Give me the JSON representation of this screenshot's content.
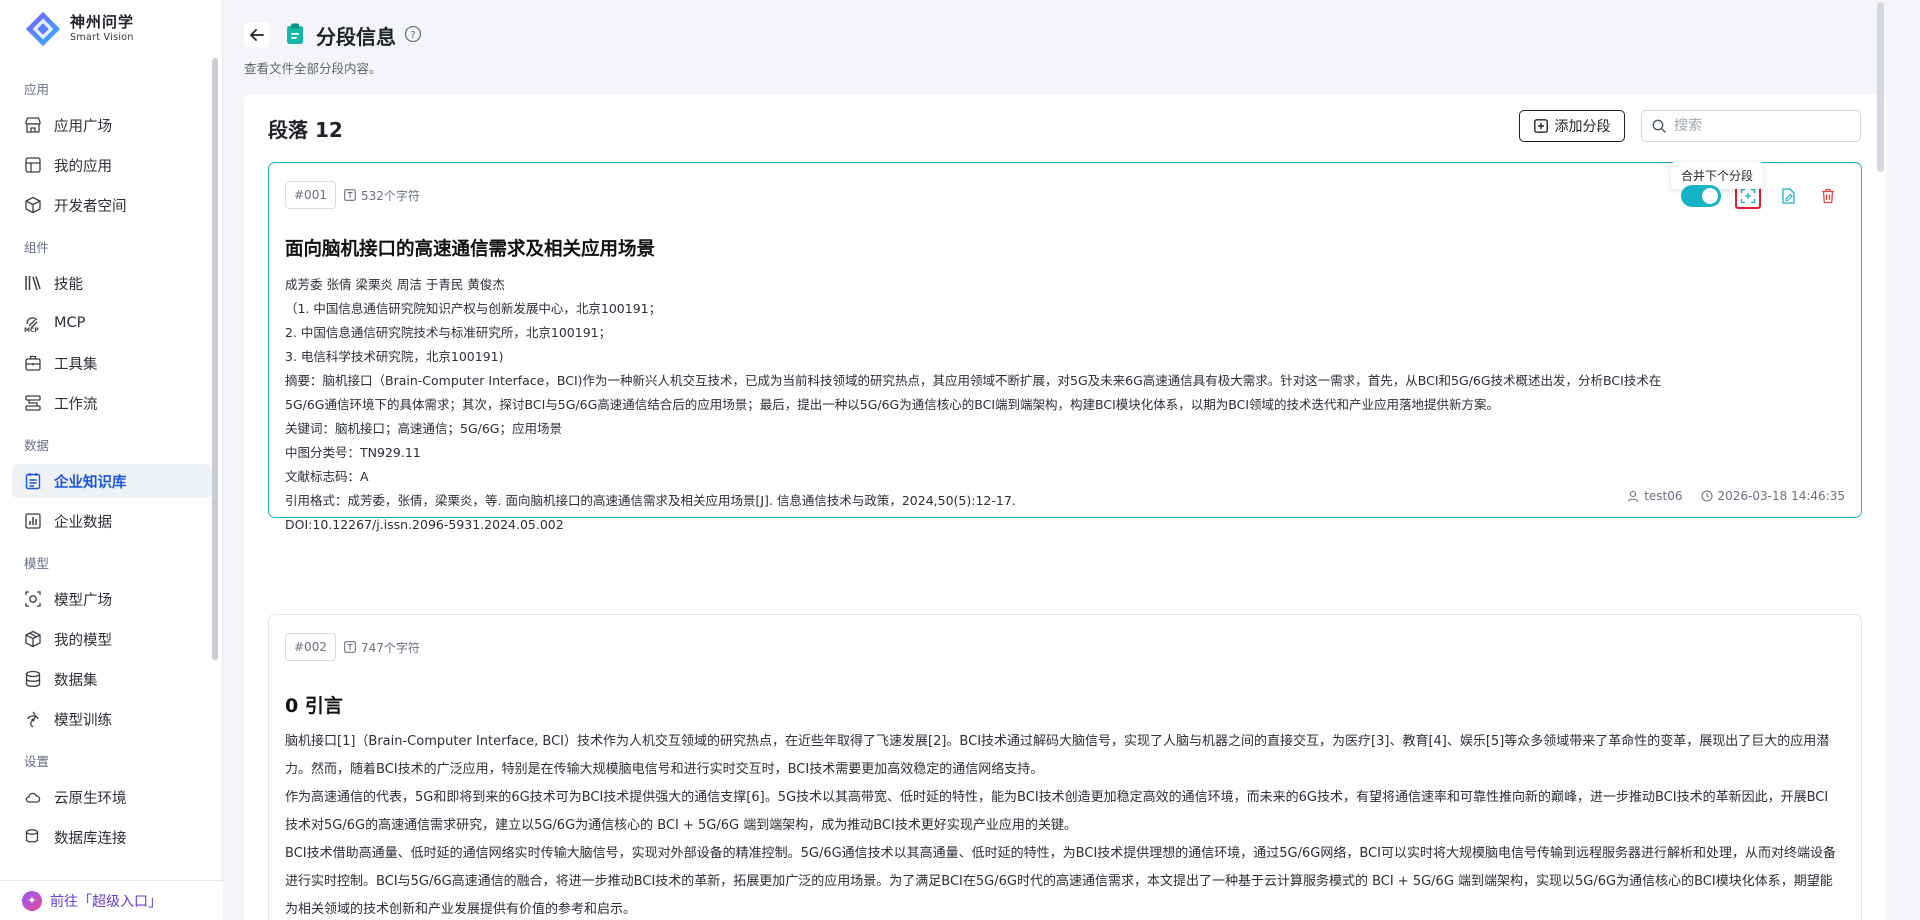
{
  "brand": {
    "name": "神州问学",
    "sub": "Smart Vision"
  },
  "nav": [
    {
      "title": "应用",
      "items": [
        {
          "label": "应用广场",
          "icon": "store-icon"
        },
        {
          "label": "我的应用",
          "icon": "grid-icon"
        },
        {
          "label": "开发者空间",
          "icon": "cube-icon"
        }
      ]
    },
    {
      "title": "组件",
      "items": [
        {
          "label": "技能",
          "icon": "books-icon"
        },
        {
          "label": "MCP",
          "icon": "mcp-icon"
        },
        {
          "label": "工具集",
          "icon": "toolbox-icon"
        },
        {
          "label": "工作流",
          "icon": "workflow-icon"
        }
      ]
    },
    {
      "title": "数据",
      "items": [
        {
          "label": "企业知识库",
          "icon": "knowledge-icon",
          "active": true
        },
        {
          "label": "企业数据",
          "icon": "chart-icon"
        }
      ]
    },
    {
      "title": "模型",
      "items": [
        {
          "label": "模型广场",
          "icon": "model-icon"
        },
        {
          "label": "我的模型",
          "icon": "box-icon"
        },
        {
          "label": "数据集",
          "icon": "database-icon"
        },
        {
          "label": "模型训练",
          "icon": "train-icon"
        }
      ]
    },
    {
      "title": "设置",
      "items": [
        {
          "label": "云原生环境",
          "icon": "cloud-icon"
        },
        {
          "label": "数据库连接",
          "icon": "db-link-icon"
        }
      ]
    }
  ],
  "footer": {
    "label": "前往「超级入口」"
  },
  "header": {
    "title": "分段信息",
    "desc": "查看文件全部分段内容。"
  },
  "panel": {
    "title": "段落 12",
    "add_label": "添加分段",
    "search_placeholder": "搜索"
  },
  "tooltip": "合并下个分段",
  "cards": [
    {
      "seq": "#001",
      "chars": "532个字符",
      "heading": "面向脑机接口的高速通信需求及相关应用场景",
      "lines": [
        "成芳委 张倩 梁栗炎 周洁 于青民 黄俊杰",
        "（1. 中国信息通信研究院知识产权与创新发展中心，北京100191；",
        "2. 中国信息通信研究院技术与标准研究所，北京100191；",
        "3. 电信科学技术研究院，北京100191)",
        "摘要：脑机接口（Brain-Computer Interface，BCI)作为一种新兴人机交互技术，已成为当前科技领域的研究热点，其应用领域不断扩展，对5G及未来6G高速通信具有极大需求。针对这一需求，首先，从BCI和5G/6G技术概述出发，分析BCI技术在",
        "5G/6G通信环境下的具体需求；其次，探讨BCI与5G/6G高速通信结合后的应用场景；最后，提出一种以5G/6G为通信核心的BCI端到端架构，构建BCI模块化体系，以期为BCI领域的技术迭代和产业应用落地提供新方案。",
        "关键词：脑机接口；高速通信；5G/6G；应用场景",
        "中图分类号：TN929.11",
        "文献标志码：A",
        "引用格式：成芳委，张倩，梁栗炎，等. 面向脑机接口的高速通信需求及相关应用场景[J]. 信息通信技术与政策，2024,50(5):12-17.",
        "DOI:10.12267/j.issn.2096-5931.2024.05.002"
      ],
      "user": "test06",
      "time": "2026-03-18 14:46:35"
    },
    {
      "seq": "#002",
      "chars": "747个字符",
      "heading": "0 引言",
      "paras": [
        "脑机接口[1]（Brain-Computer Interface, BCI）技术作为人机交互领域的研究热点，在近些年取得了飞速发展[2]。BCI技术通过解码大脑信号，实现了人脑与机器之间的直接交互，为医疗[3]、教育[4]、娱乐[5]等众多领域带来了革命性的变革，展现出了巨大的应用潜力。然而，随着BCI技术的广泛应用，特别是在传输大规模脑电信号和进行实时交互时，BCI技术需要更加高效稳定的通信网络支持。",
        "作为高速通信的代表，5G和即将到来的6G技术可为BCI技术提供强大的通信支撑[6]。5G技术以其高带宽、低时延的特性，能为BCI技术创造更加稳定高效的通信环境，而未来的6G技术，有望将通信速率和可靠性推向新的巅峰，进一步推动BCI技术的革新因此，开展BCI技术对5G/6G的高速通信需求研究，建立以5G/6G为通信核心的 BCI + 5G/6G 端到端架构，成为推动BCI技术更好实现产业应用的关键。",
        "BCI技术借助高通量、低时延的通信网络实时传输大脑信号，实现对外部设备的精准控制。5G/6G通信技术以其高通量、低时延的特性，为BCI技术提供理想的通信环境，通过5G/6G网络，BCI可以实时将大规模脑电信号传输到远程服务器进行解析和处理，从而对终端设备进行实时控制。BCI与5G/6G高速通信的融合，将进一步推动BCI技术的革新，拓展更加广泛的应用场景。为了满足BCI在5G/6G时代的高速通信需求，本文提出了一种基于云计算服务模式的 BCI + 5G/6G 端到端架构，实现以5G/6G为通信核心的BCI模块化体系，期望能为相关领域的技术创新和产业发展提供有价值的参考和启示。"
      ]
    }
  ]
}
